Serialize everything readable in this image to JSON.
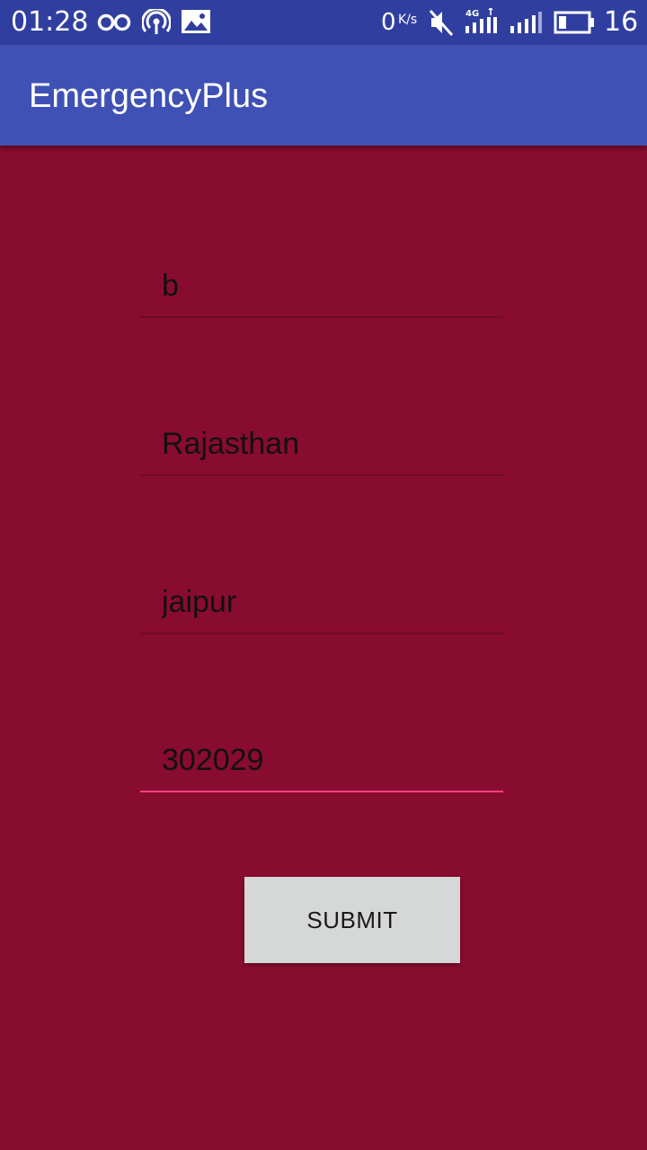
{
  "status_bar": {
    "time": "01:28",
    "net_speed_value": "0",
    "net_speed_unit": "K/s",
    "battery_level": "16",
    "icons": [
      "voicemail-icon",
      "hotspot-icon",
      "image-icon",
      "mute-icon",
      "signal-4g-icon",
      "signal-icon",
      "battery-icon"
    ]
  },
  "app_bar": {
    "title": "EmergencyPlus",
    "color": "#3f51b5"
  },
  "form": {
    "fields": [
      {
        "value": "b"
      },
      {
        "value": "Rajasthan"
      },
      {
        "value": "jaipur"
      },
      {
        "value": "302029",
        "focused": true
      }
    ],
    "submit_label": "SUBMIT"
  },
  "colors": {
    "background": "#880c2f",
    "status_bar": "#303f9f",
    "accent": "#ff4081",
    "button": "#d6d7d7"
  }
}
